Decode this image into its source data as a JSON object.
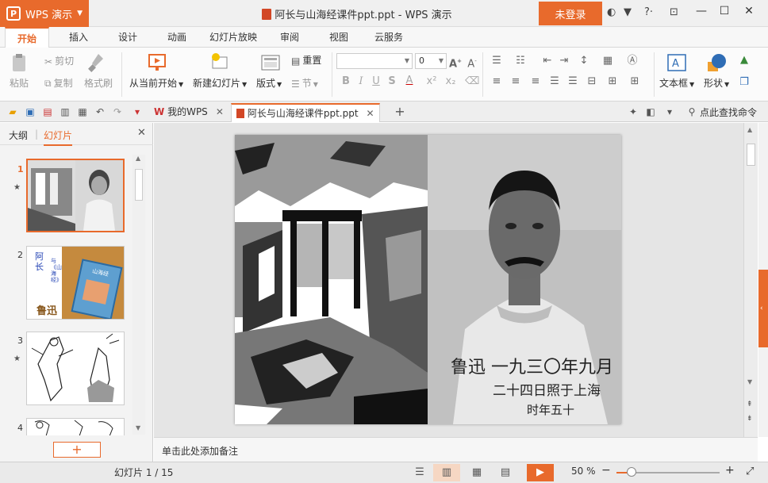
{
  "app": {
    "name": "WPS 演示",
    "logo_letter": "P"
  },
  "window": {
    "title": "阿长与山海经课件ppt.ppt - WPS 演示",
    "login_label": "未登录"
  },
  "menu_tabs": [
    "开始",
    "插入",
    "设计",
    "动画",
    "幻灯片放映",
    "审阅",
    "视图",
    "云服务"
  ],
  "active_menu_tab": 0,
  "ribbon": {
    "paste": "粘贴",
    "cut": "剪切",
    "copy": "复制",
    "format_painter": "格式刷",
    "from_current": "从当前开始",
    "new_slide": "新建幻灯片",
    "layout": "版式",
    "reset": "重置",
    "section": "节",
    "font_name": "",
    "font_size": "0",
    "textbox": "文本框",
    "shape": "形状"
  },
  "doc_tabs": [
    {
      "label": "我的WPS"
    },
    {
      "label": "阿长与山海经课件ppt.ppt"
    }
  ],
  "search_command": "点此查找命令",
  "left_panel": {
    "tab_outline": "大纲",
    "tab_slides": "幻灯片",
    "slides": [
      {
        "num": "1",
        "star": "★"
      },
      {
        "num": "2",
        "star": ""
      },
      {
        "num": "3",
        "star": "★"
      },
      {
        "num": "4",
        "star": ""
      }
    ],
    "add_label": "+"
  },
  "slide_content": {
    "calligraphy_line1": "鲁迅 一九三〇年九月",
    "calligraphy_line2": "二十四日照于上海",
    "calligraphy_line3": "时年五十"
  },
  "thumb2": {
    "title_chars": "阿长",
    "subtitle": "与《山海经》",
    "author": "鲁迅",
    "book_title": "山海经"
  },
  "notes_placeholder": "单击此处添加备注",
  "status": {
    "slide_info": "幻灯片 1 / 15",
    "zoom": "50 %",
    "zoom_value": 0.5
  },
  "colors": {
    "accent": "#e86a2c"
  }
}
